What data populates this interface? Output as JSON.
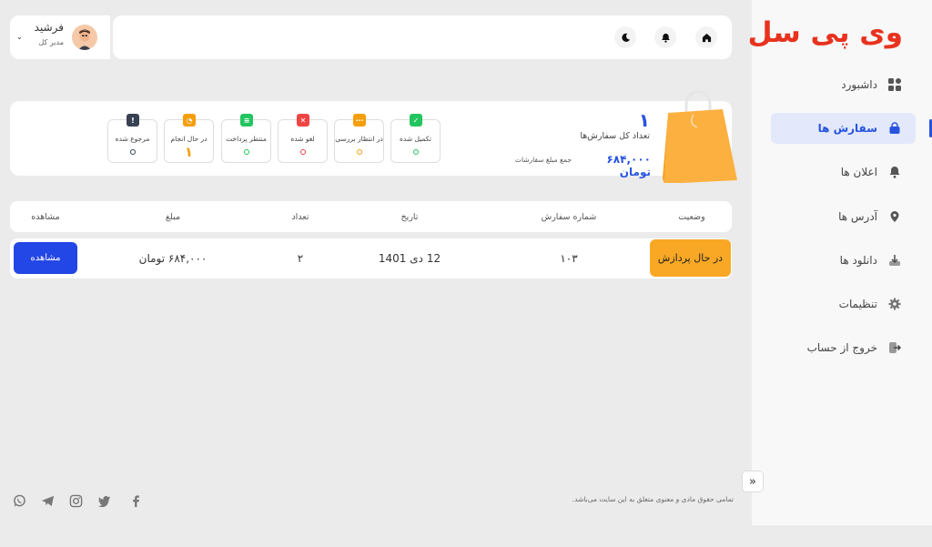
{
  "brand": {
    "logo_text": "وی پی سل",
    "color": "#e8321e"
  },
  "sidebar": {
    "items": [
      {
        "label": "داشبورد",
        "icon": "dashboard-icon",
        "active": false
      },
      {
        "label": "سفارش ها",
        "icon": "shopping-bag-icon",
        "active": true
      },
      {
        "label": "اعلان ها",
        "icon": "bell-icon",
        "active": false
      },
      {
        "label": "آدرس ها",
        "icon": "location-pin-icon",
        "active": false
      },
      {
        "label": "دانلود ها",
        "icon": "download-icon",
        "active": false
      },
      {
        "label": "تنظیمات",
        "icon": "gear-icon",
        "active": false
      },
      {
        "label": "خروج از حساب",
        "icon": "logout-icon",
        "active": false
      }
    ],
    "collapse_label": "»"
  },
  "header": {
    "user_name": "فرشید",
    "user_role": "مدیر کل",
    "icons": [
      "home-icon",
      "bell-icon",
      "moon-icon"
    ]
  },
  "summary": {
    "total_orders_value": "۱",
    "total_orders_label": "تعداد کل سفارش‌ها",
    "total_amount_value": "۶۸۴,۰۰۰  تومان",
    "total_amount_label": "جمع مبلغ سفارشات",
    "stats": [
      {
        "label": "تکمیل شده",
        "value": "",
        "color": "#22c55e",
        "icon": "check-icon"
      },
      {
        "label": "در انتظار بررسی",
        "value": "",
        "color": "#f59e0b",
        "icon": "dots-icon"
      },
      {
        "label": "لغو شده",
        "value": "",
        "color": "#ef4444",
        "icon": "x-icon"
      },
      {
        "label": "منتظر پرداخت",
        "value": "",
        "color": "#22c55e",
        "icon": "wallet-icon"
      },
      {
        "label": "در حال انجام",
        "value": "۱",
        "color": "#f59e0b",
        "icon": "clock-icon"
      },
      {
        "label": "مرجوع شده",
        "value": "",
        "color": "#374151",
        "icon": "alert-icon"
      }
    ]
  },
  "table": {
    "headers": [
      "وضعیت",
      "شماره سفارش",
      "تاریخ",
      "تعداد",
      "مبلغ",
      "مشاهده"
    ],
    "rows": [
      {
        "status": "در حال پردازش",
        "order_no": "۱۰۳",
        "date": "12 دی 1401",
        "qty": "۲",
        "amount": "۶۸۴,۰۰۰ تومان",
        "action": "مشاهده"
      }
    ],
    "status_color": "#f9a825",
    "action_color": "#2346e6"
  },
  "footer": {
    "copyright": "تمامی حقوق مادی و معنوی متعلق به این سایت می‌باشد.",
    "social": [
      "whatsapp-icon",
      "telegram-icon",
      "instagram-icon",
      "twitter-icon",
      "facebook-icon"
    ]
  }
}
